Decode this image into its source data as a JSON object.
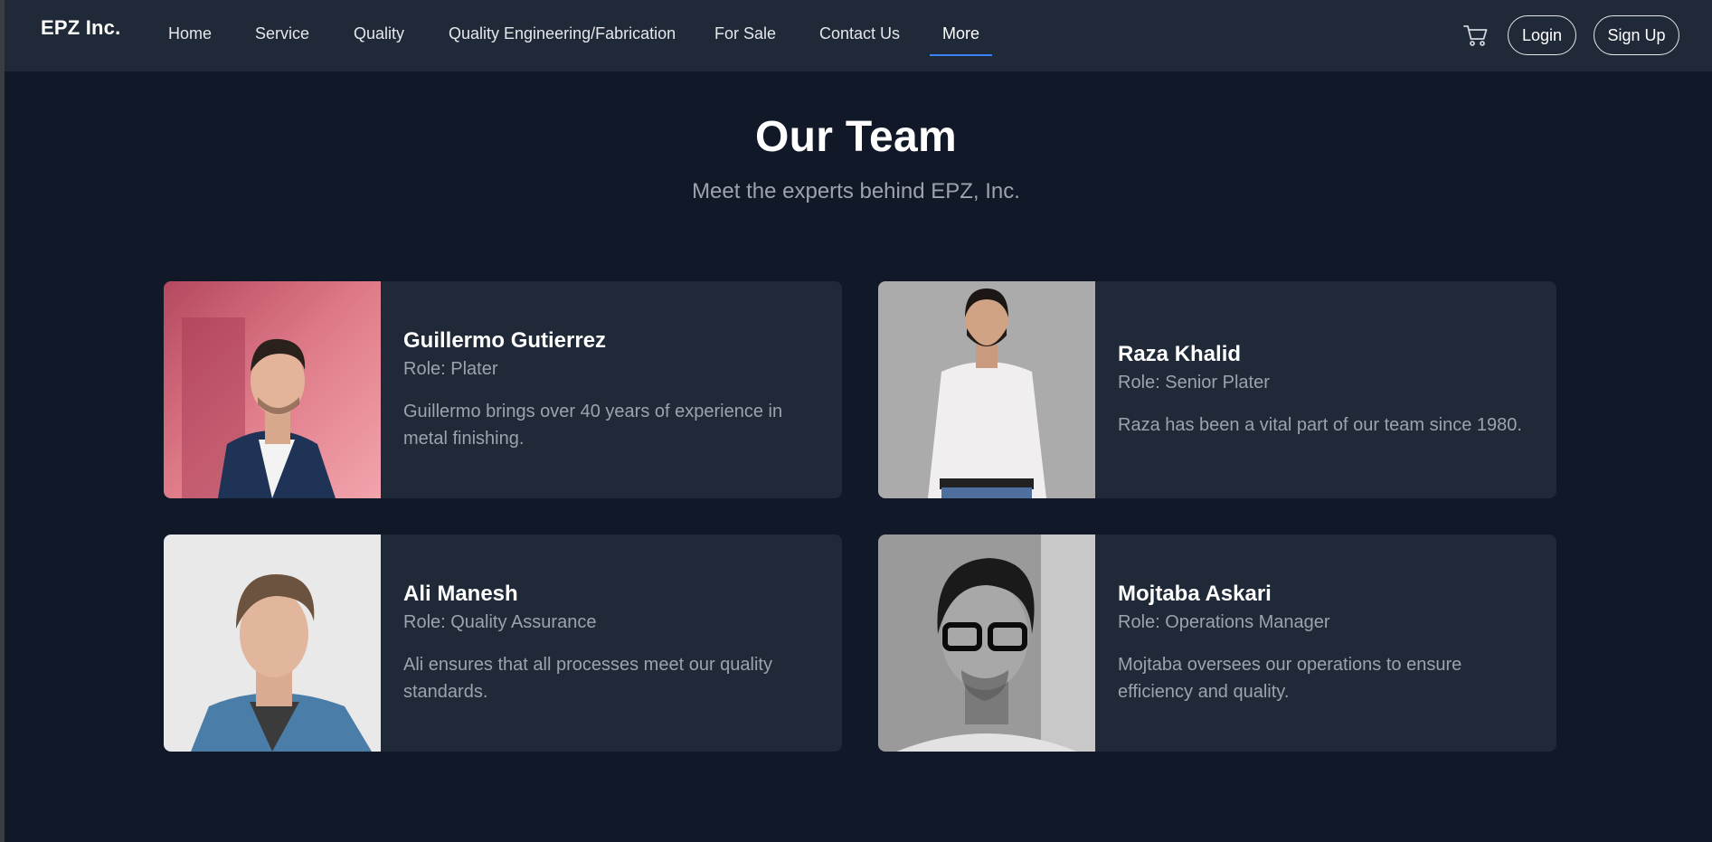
{
  "header": {
    "logo": "EPZ Inc.",
    "nav": [
      {
        "label": "Home"
      },
      {
        "label": "Service"
      },
      {
        "label": "Quality"
      },
      {
        "label": "Quality Engineering/Fabrication"
      },
      {
        "label": "For Sale"
      },
      {
        "label": "Contact Us"
      },
      {
        "label": "More",
        "active": true
      }
    ],
    "cart_icon": "cart-icon",
    "login_label": "Login",
    "signup_label": "Sign Up"
  },
  "main": {
    "title": "Our Team",
    "subtitle": "Meet the experts behind EPZ, Inc."
  },
  "team": [
    {
      "name": "Guillermo Gutierrez",
      "role": "Role: Plater",
      "desc": "Guillermo brings over 40 years of experience in metal finishing."
    },
    {
      "name": "Raza Khalid",
      "role": "Role: Senior Plater",
      "desc": "Raza has been a vital part of our team since 1980."
    },
    {
      "name": "Ali Manesh",
      "role": "Role: Quality Assurance",
      "desc": "Ali ensures that all processes meet our quality standards."
    },
    {
      "name": "Mojtaba Askari",
      "role": "Role: Operations Manager",
      "desc": "Mojtaba oversees our operations to ensure efficiency and quality."
    }
  ],
  "colors": {
    "background": "#111827",
    "navbar": "#1f2937",
    "card": "#1f2937",
    "accent": "#3b82f6",
    "muted_text": "#9ca3af"
  }
}
